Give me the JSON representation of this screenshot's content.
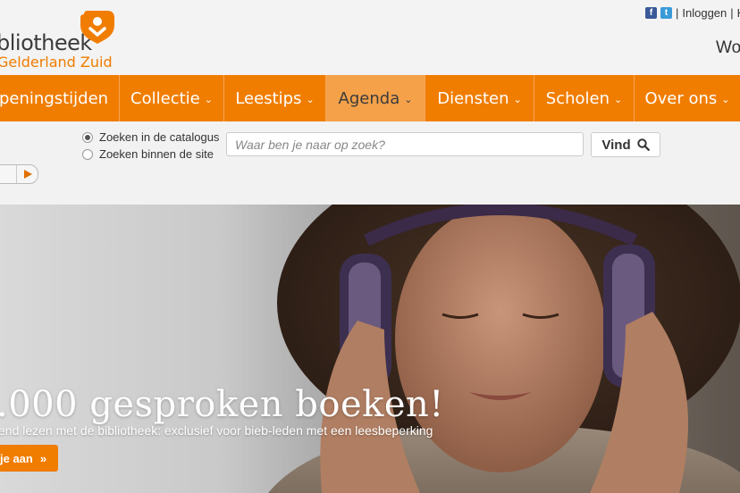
{
  "logo": {
    "line1": "bliotheek",
    "line2": "Gelderland Zuid"
  },
  "top_links": {
    "login": "Inloggen",
    "separator": "|",
    "truncated": "H"
  },
  "top_right_text": "Wo",
  "nav": {
    "items": [
      {
        "label": "peningstijden",
        "has_chevron": false
      },
      {
        "label": "Collectie",
        "has_chevron": true
      },
      {
        "label": "Leestips",
        "has_chevron": true
      },
      {
        "label": "Agenda",
        "has_chevron": true,
        "active": true
      },
      {
        "label": "Diensten",
        "has_chevron": true
      },
      {
        "label": "Scholen",
        "has_chevron": true
      },
      {
        "label": "Over ons",
        "has_chevron": true
      }
    ]
  },
  "search": {
    "options": [
      {
        "label": "Zoeken in de catalogus",
        "selected": true
      },
      {
        "label": "Zoeken binnen de site",
        "selected": false
      }
    ],
    "placeholder": "Waar ben je naar op zoek?",
    "button_label": "Vind"
  },
  "hero": {
    "title": ".000 gesproken boeken!",
    "subtitle": "end lezen met de bibliotheek: exclusief voor bieb-leden met een leesbeperking",
    "button_label": "je aan"
  },
  "colors": {
    "accent": "#f07d00",
    "nav_active_bg": "#f4a14a",
    "nav_active_text": "#3b3b3b"
  },
  "icons": {
    "facebook": "facebook-icon",
    "twitter": "twitter-icon",
    "search": "search-icon",
    "play": "play-icon",
    "arrow": "double-arrow-icon"
  }
}
